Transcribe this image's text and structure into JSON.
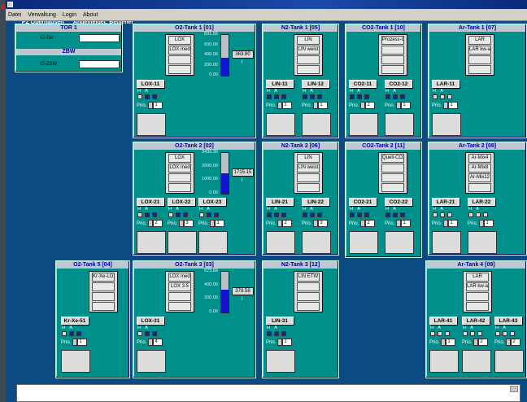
{
  "window": {
    "title": "PZ Oberhausen      Angemeldet: Bediener"
  },
  "menu": [
    "Datei",
    "Verwaltung",
    "Login",
    "About"
  ],
  "tor": {
    "title": "TOR 1",
    "id_tor_label": "ID-Tor",
    "zbw_title": "ZBW",
    "id_zbw_label": "ID-ZBW"
  },
  "tanks": {
    "o2_1": {
      "title": "O2-Tank 1  [01]",
      "lines": [
        "LOX",
        "LOX med",
        "",
        ""
      ],
      "scale": [
        "831.55",
        "600.00",
        "400.00",
        "200.00",
        "0.00"
      ],
      "value": "363.80",
      "unit": "l",
      "level": 0.437,
      "pumps": [
        {
          "name": "LOX-11",
          "ha": "H  A",
          "prio_label": "Prio.",
          "prio": "1",
          "leds": [
            false,
            true,
            true
          ]
        }
      ]
    },
    "n2_1": {
      "title": "N2-Tank 1  [05]",
      "lines": [
        "LIN",
        "LIN weist",
        "",
        ""
      ],
      "pumps": [
        {
          "name": "LIN-11",
          "ha": "H  A",
          "prio_label": "Prio.",
          "prio": "1",
          "leds": [
            true,
            true,
            true
          ]
        },
        {
          "name": "LIN-12",
          "ha": "H  A",
          "prio_label": "Prio.",
          "prio": "1",
          "leds": [
            true,
            true,
            true
          ]
        }
      ]
    },
    "co2_1": {
      "title": "CO2-Tank 1  [10]",
      "lines": [
        "Prozess-CO2",
        "",
        "",
        ""
      ],
      "pumps": [
        {
          "name": "CO2-11",
          "ha": "H  A",
          "prio_label": "Prio.",
          "prio": "2",
          "leds": [
            true,
            true,
            true
          ]
        },
        {
          "name": "CO2-12",
          "ha": "H  A",
          "prio_label": "Prio.",
          "prio": "1",
          "leds": [
            true,
            true,
            true
          ]
        }
      ]
    },
    "ar_1": {
      "title": "Ar-Tank 1  [07]",
      "lines": [
        "LAR",
        "LAR kw-arm",
        "",
        ""
      ],
      "pumps": [
        {
          "name": "LAR-11",
          "ha": "H  A",
          "prio_label": "Prio.",
          "prio": "1",
          "leds": [
            false,
            false,
            false
          ]
        }
      ]
    },
    "o2_2": {
      "title": "O2-Tank 2  [02]",
      "lines": [
        "LOX",
        "LOX med",
        "",
        ""
      ],
      "scale": [
        "3430.30",
        "2000.00",
        "1000.00",
        "0.00"
      ],
      "value": "1715.15",
      "unit": "l",
      "level": 0.5,
      "pumps": [
        {
          "name": "LOX-21",
          "ha": "H  A",
          "prio_label": "Prio.",
          "prio": "2",
          "leds": [
            false,
            true,
            true
          ]
        },
        {
          "name": "LOX-22",
          "ha": "H  A",
          "prio_label": "Prio.",
          "prio": "3",
          "leds": [
            false,
            true,
            true
          ]
        },
        {
          "name": "LOX-23",
          "ha": "H  A",
          "prio_label": "Prio.",
          "prio": "1",
          "leds": [
            false,
            true,
            true
          ]
        }
      ]
    },
    "n2_2": {
      "title": "N2-Tank 2  [06]",
      "lines": [
        "LIN",
        "LIN weist",
        "",
        ""
      ],
      "pumps": [
        {
          "name": "LIN-21",
          "ha": "H  A",
          "prio_label": "Prio.",
          "prio": "2",
          "leds": [
            true,
            true,
            true
          ]
        },
        {
          "name": "LIN-22",
          "ha": "H  A",
          "prio_label": "Prio.",
          "prio": "3",
          "leds": [
            true,
            true,
            true
          ]
        }
      ]
    },
    "co2_2": {
      "title": "CO2-Tank 2  [11]",
      "lines": [
        "Quell-CO2",
        "",
        "",
        ""
      ],
      "pumps": [
        {
          "name": "CO2-21",
          "ha": "H  A",
          "prio_label": "Prio.",
          "prio": "2",
          "leds": [
            true,
            true,
            true
          ]
        },
        {
          "name": "CO2-22",
          "ha": "H  A",
          "prio_label": "Prio.",
          "prio": "1",
          "leds": [
            true,
            true,
            true
          ]
        }
      ]
    },
    "ar_2": {
      "title": "Ar-Tank 2  [08]",
      "lines": [
        "Ar-Mix4",
        "Ar-Mix8",
        "Ar-Mix12",
        ""
      ],
      "pumps": [
        {
          "name": "LAR-21",
          "ha": "H  A",
          "prio_label": "Prio.",
          "prio": "1",
          "leds": [
            false,
            false,
            false
          ]
        },
        {
          "name": "LAR-22",
          "ha": "H  A",
          "prio_label": "Prio.",
          "prio": "1",
          "leds": [
            false,
            false,
            false
          ]
        }
      ]
    },
    "o2_5": {
      "title": "O2-Tank 5  [04]",
      "lines": [
        "Kr-Xe-LOX",
        "",
        "",
        ""
      ],
      "pumps": [
        {
          "name": "Kr-Xe-51",
          "ha": "H  A",
          "prio_label": "Prio.",
          "prio": "1",
          "leds": [
            false,
            true,
            true
          ]
        }
      ]
    },
    "o2_3": {
      "title": "O2-Tank 3  [03]",
      "lines": [
        "LOX med",
        "LOX 3.5",
        "",
        ""
      ],
      "scale": [
        "673.69",
        "400.00",
        "200.00",
        "0.00"
      ],
      "value": "378.58",
      "unit": "l",
      "level": 0.56,
      "pumps": [
        {
          "name": "LOX-31",
          "ha": "H  A",
          "prio_label": "Prio.",
          "prio": "4",
          "leds": [
            false,
            true,
            true
          ]
        }
      ]
    },
    "n2_3": {
      "title": "N2-Tank 3  [12]",
      "lines": [
        "LIN ETW",
        "",
        "",
        ""
      ],
      "pumps": [
        {
          "name": "LIN-31",
          "ha": "H  A",
          "prio_label": "Prio.",
          "prio": "1",
          "leds": [
            true,
            true,
            true
          ]
        }
      ]
    },
    "ar_4": {
      "title": "Ar-Tank 4  [09]",
      "lines": [
        "LAR",
        "LAR kw-arm",
        "",
        ""
      ],
      "pumps": [
        {
          "name": "LAR-41",
          "ha": "H  A",
          "prio_label": "Prio.",
          "prio": "1",
          "leds": [
            false,
            false,
            false
          ]
        },
        {
          "name": "LAR-42",
          "ha": "H  A",
          "prio_label": "Prio.",
          "prio": "2",
          "leds": [
            false,
            false,
            false
          ]
        },
        {
          "name": "LAR-43",
          "ha": "H  A",
          "prio_label": "Prio.",
          "prio": "2",
          "leds": [
            false,
            false,
            false
          ]
        }
      ]
    }
  }
}
